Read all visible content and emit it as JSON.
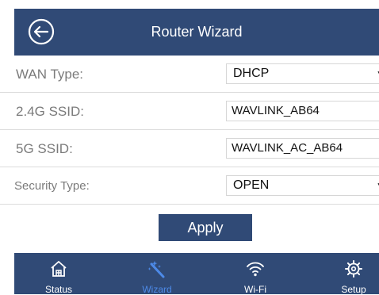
{
  "header": {
    "title": "Router Wizard",
    "back_icon": "back-arrow-circle-icon"
  },
  "form": {
    "wan_type": {
      "label": "WAN Type:",
      "value": "DHCP"
    },
    "ssid_24g": {
      "label": "2.4G SSID:",
      "value": "WAVLINK_AB64"
    },
    "ssid_5g": {
      "label": "5G SSID:",
      "value": "WAVLINK_AC_AB64"
    },
    "security_type": {
      "label": "Security Type:",
      "value": "OPEN"
    },
    "dropdown_glyph": "▼"
  },
  "apply_label": "Apply",
  "tabs": {
    "status": {
      "label": "Status",
      "icon": "house-icon"
    },
    "wizard": {
      "label": "Wizard",
      "icon": "magic-wand-icon",
      "active": true
    },
    "wifi": {
      "label": "Wi-Fi",
      "icon": "wifi-icon"
    },
    "setup": {
      "label": "Setup",
      "icon": "gear-icon"
    }
  },
  "colors": {
    "primary": "#304a76",
    "active_tab": "#4d8ae8",
    "label_text": "#7b7b7b",
    "divider": "#dcdcdc"
  }
}
